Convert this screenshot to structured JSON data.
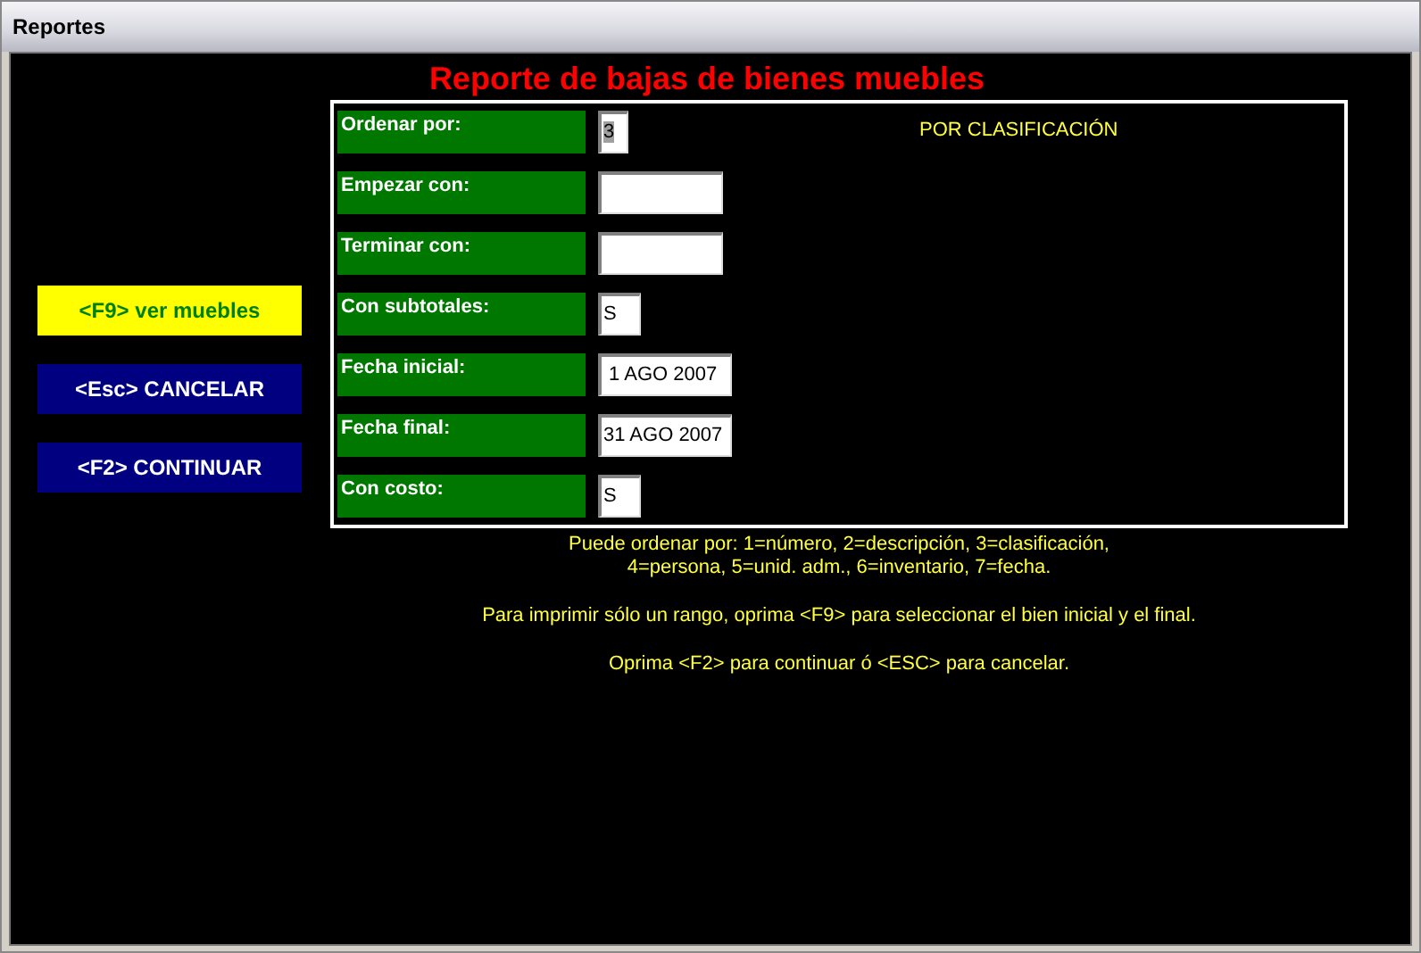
{
  "window": {
    "title": "Reportes"
  },
  "heading": "Reporte de bajas de bienes muebles",
  "buttons": [
    {
      "label": "<F9> ver muebles",
      "selected": true
    },
    {
      "label": "<Esc> CANCELAR",
      "selected": false
    },
    {
      "label": "<F2> CONTINUAR",
      "selected": false
    }
  ],
  "fields": [
    {
      "label": "Ordenar por:",
      "value": "3",
      "text_selected": true
    },
    {
      "label": "Empezar con:"
    },
    {
      "label": "Terminar con:"
    },
    {
      "label": "Con subtotales:",
      "value": "S"
    },
    {
      "label": "Fecha inicial:",
      "value": " 1 AGO 2007"
    },
    {
      "label": "Fecha final:",
      "value": "31 AGO 2007"
    },
    {
      "label": "Con costo:",
      "value": "S"
    }
  ],
  "order_caption": "POR CLASIFICACIÓN",
  "help": [
    "Puede ordenar por: 1=número, 2=descripción, 3=clasificación,",
    "4=persona, 5=unid. adm., 6=inventario, 7=fecha.",
    "Para imprimir sólo un rango, oprima <F9> para seleccionar el bien inicial y el final.",
    "Oprima <F2> para continuar ó <ESC> para cancelar."
  ]
}
